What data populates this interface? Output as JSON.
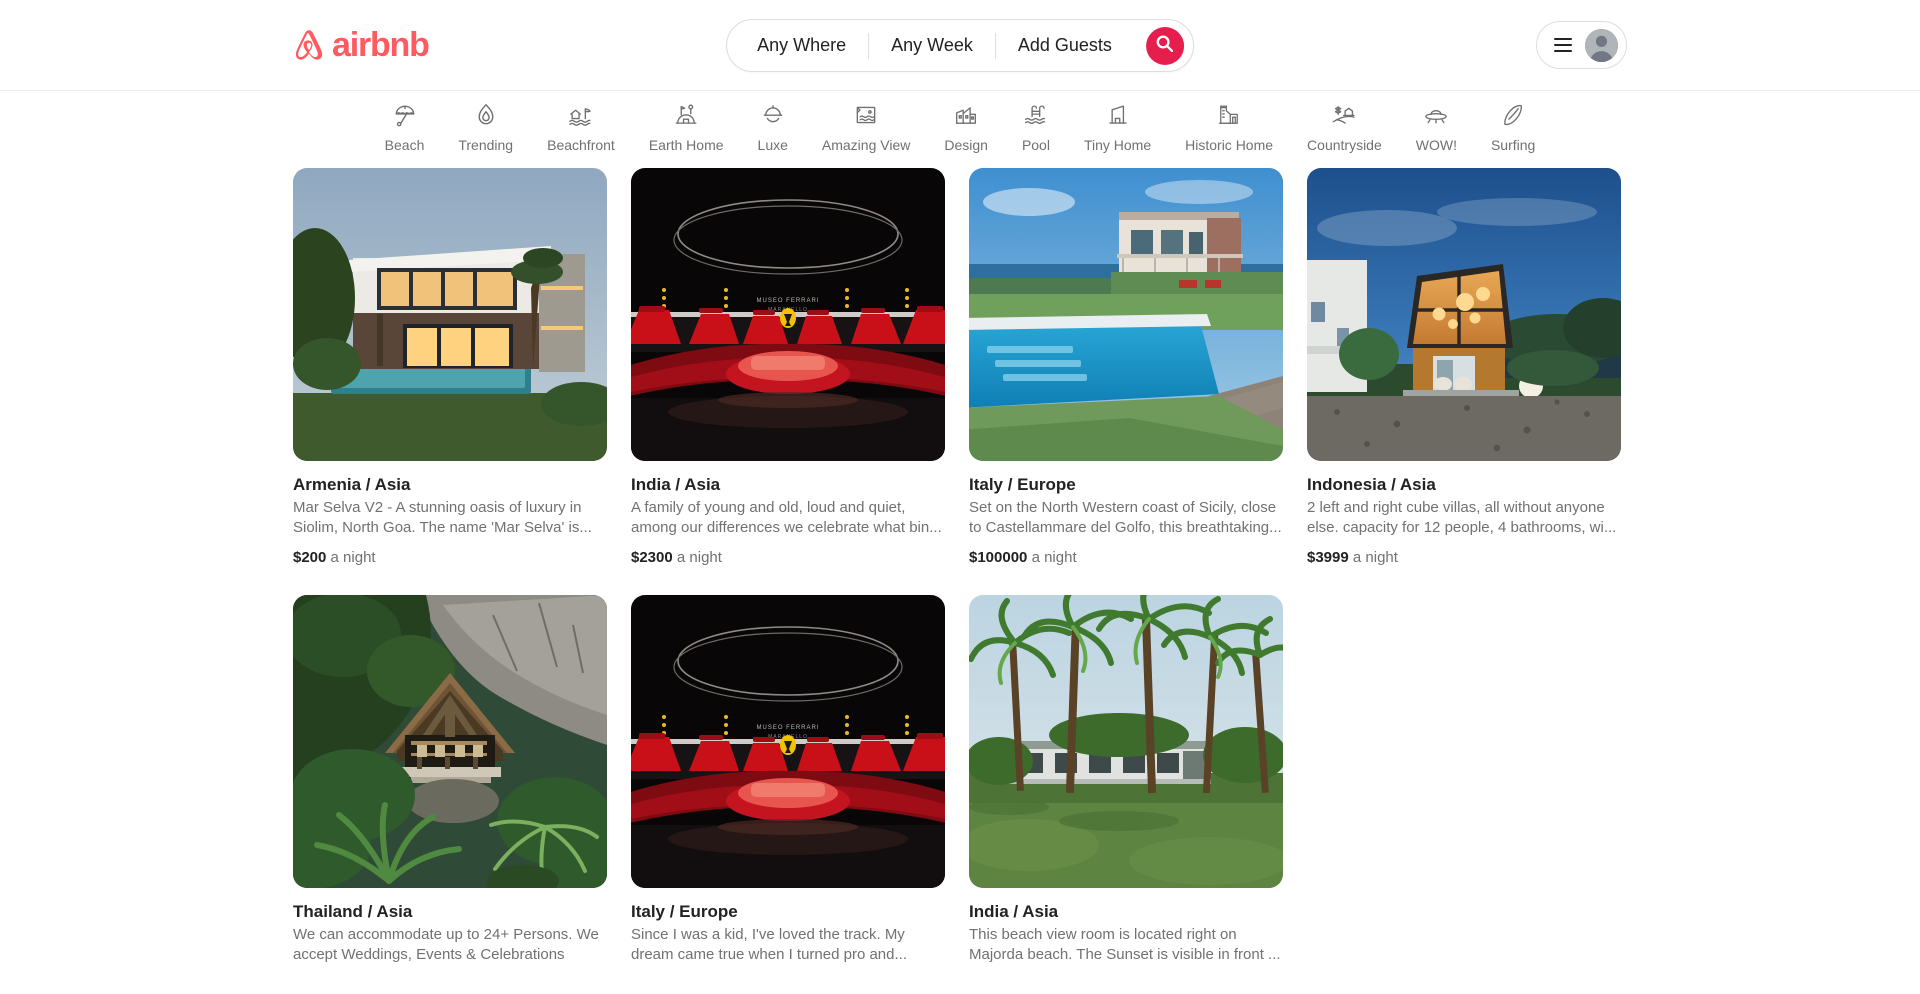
{
  "header": {
    "logo_text": "airbnb",
    "logo_color": "#FF5A5F",
    "search": {
      "where_label": "Any Where",
      "week_label": "Any Week",
      "guests_label": "Add Guests",
      "button_color": "#E61E4D"
    },
    "profile": {
      "menu_label": "menu",
      "avatar_label": "user"
    }
  },
  "categories": [
    {
      "label": "Beach",
      "icon": "beach-umbrella-icon"
    },
    {
      "label": "Trending",
      "icon": "flame-icon"
    },
    {
      "label": "Beachfront",
      "icon": "beachfront-icon"
    },
    {
      "label": "Earth Home",
      "icon": "earth-home-icon"
    },
    {
      "label": "Luxe",
      "icon": "luxe-dome-icon"
    },
    {
      "label": "Amazing View",
      "icon": "amazing-view-icon"
    },
    {
      "label": "Design",
      "icon": "design-icon"
    },
    {
      "label": "Pool",
      "icon": "pool-icon"
    },
    {
      "label": "Tiny Home",
      "icon": "tiny-home-icon"
    },
    {
      "label": "Historic Home",
      "icon": "historic-home-icon"
    },
    {
      "label": "Countryside",
      "icon": "countryside-icon"
    },
    {
      "label": "WOW!",
      "icon": "ufo-icon"
    },
    {
      "label": "Surfing",
      "icon": "surfboard-icon"
    }
  ],
  "price_suffix": "a night",
  "listings": [
    {
      "title": "Armenia / Asia",
      "description": "Mar Selva V2 - A stunning oasis of luxury in Siolim, North Goa. The name 'Mar Selva' is...",
      "price": "$200",
      "price_suffix": "a night",
      "image": "modern-villa-dusk-pool"
    },
    {
      "title": "India / Asia",
      "description": "A family of young and old, loud and quiet, among our differences we celebrate what bin...",
      "price": "$2300",
      "price_suffix": "a night",
      "image": "ferrari-museum-hall"
    },
    {
      "title": "Italy / Europe",
      "description": "Set on the North Western coast of Sicily, close to Castellammare del Golfo, this breathtaking...",
      "price": "$100000",
      "price_suffix": "a night",
      "image": "sicily-infinity-pool-villa"
    },
    {
      "title": "Indonesia / Asia",
      "description": "2 left and right cube villas, all without anyone else. capacity for 12 people, 4 bathrooms, wi...",
      "price": "$3999",
      "price_suffix": "a night",
      "image": "angular-cube-villa-night"
    },
    {
      "title": "Thailand / Asia",
      "description": "We can accommodate up to 24+ Persons. We accept Weddings, Events & Celebrations",
      "price": "",
      "price_suffix": "",
      "image": "jungle-cliff-thatched-villa"
    },
    {
      "title": "Italy / Europe",
      "description": "Since I was a kid, I've loved the track. My dream came true when I turned pro and...",
      "price": "",
      "price_suffix": "",
      "image": "ferrari-museum-hall"
    },
    {
      "title": "India / Asia",
      "description": "This beach view room is located right on Majorda beach. The Sunset is visible in front ...",
      "price": "",
      "price_suffix": "",
      "image": "palm-beach-bungalow"
    }
  ]
}
